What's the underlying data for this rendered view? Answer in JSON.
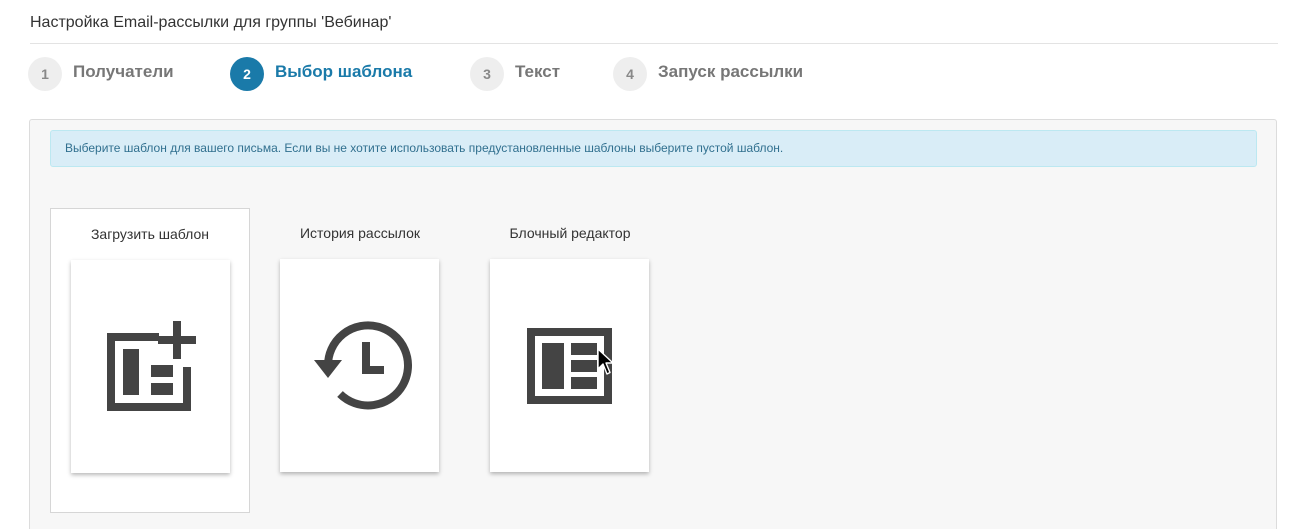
{
  "header": {
    "title": "Настройка Email-рассылки для группы 'Вебинар'"
  },
  "steps": [
    {
      "number": "1",
      "label": "Получатели",
      "active": false
    },
    {
      "number": "2",
      "label": "Выбор шаблона",
      "active": true
    },
    {
      "number": "3",
      "label": "Текст",
      "active": false
    },
    {
      "number": "4",
      "label": "Запуск рассылки",
      "active": false
    }
  ],
  "info": {
    "text": "Выберите шаблон для вашего письма. Если вы не хотите использовать предустановленные шаблоны выберите пустой шаблон."
  },
  "templates": [
    {
      "label": "Загрузить шаблон",
      "icon": "upload-template-icon",
      "selected": true
    },
    {
      "label": "История рассылок",
      "icon": "history-icon",
      "selected": false
    },
    {
      "label": "Блочный редактор",
      "icon": "block-editor-icon",
      "selected": false
    }
  ],
  "colors": {
    "accent": "#1a7aa9",
    "icon": "#444444",
    "alert_background": "#d9edf7",
    "alert_text": "#31708f"
  }
}
